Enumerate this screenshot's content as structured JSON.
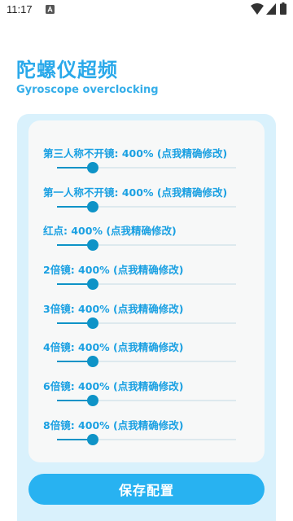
{
  "status_bar": {
    "time": "11:17"
  },
  "header": {
    "title": "陀螺仪超频",
    "subtitle": "Gyroscope overclocking"
  },
  "sliders": [
    {
      "label": "第三人称不开镜: 400% (点我精确修改)",
      "value_fraction": 0.2
    },
    {
      "label": "第一人称不开镜: 400% (点我精确修改)",
      "value_fraction": 0.2
    },
    {
      "label": "红点: 400% (点我精确修改)",
      "value_fraction": 0.2
    },
    {
      "label": "2倍镜: 400% (点我精确修改)",
      "value_fraction": 0.2
    },
    {
      "label": "3倍镜: 400% (点我精确修改)",
      "value_fraction": 0.2
    },
    {
      "label": "4倍镜: 400% (点我精确修改)",
      "value_fraction": 0.2
    },
    {
      "label": "6倍镜: 400% (点我精确修改)",
      "value_fraction": 0.2
    },
    {
      "label": "8倍镜: 400% (点我精确修改)",
      "value_fraction": 0.2
    }
  ],
  "save_button": {
    "label": "保存配置"
  },
  "colors": {
    "accent": "#2aa9ea",
    "slider": "#0e93c7",
    "panel": "#d9f1fc",
    "button": "#28b2f1"
  }
}
